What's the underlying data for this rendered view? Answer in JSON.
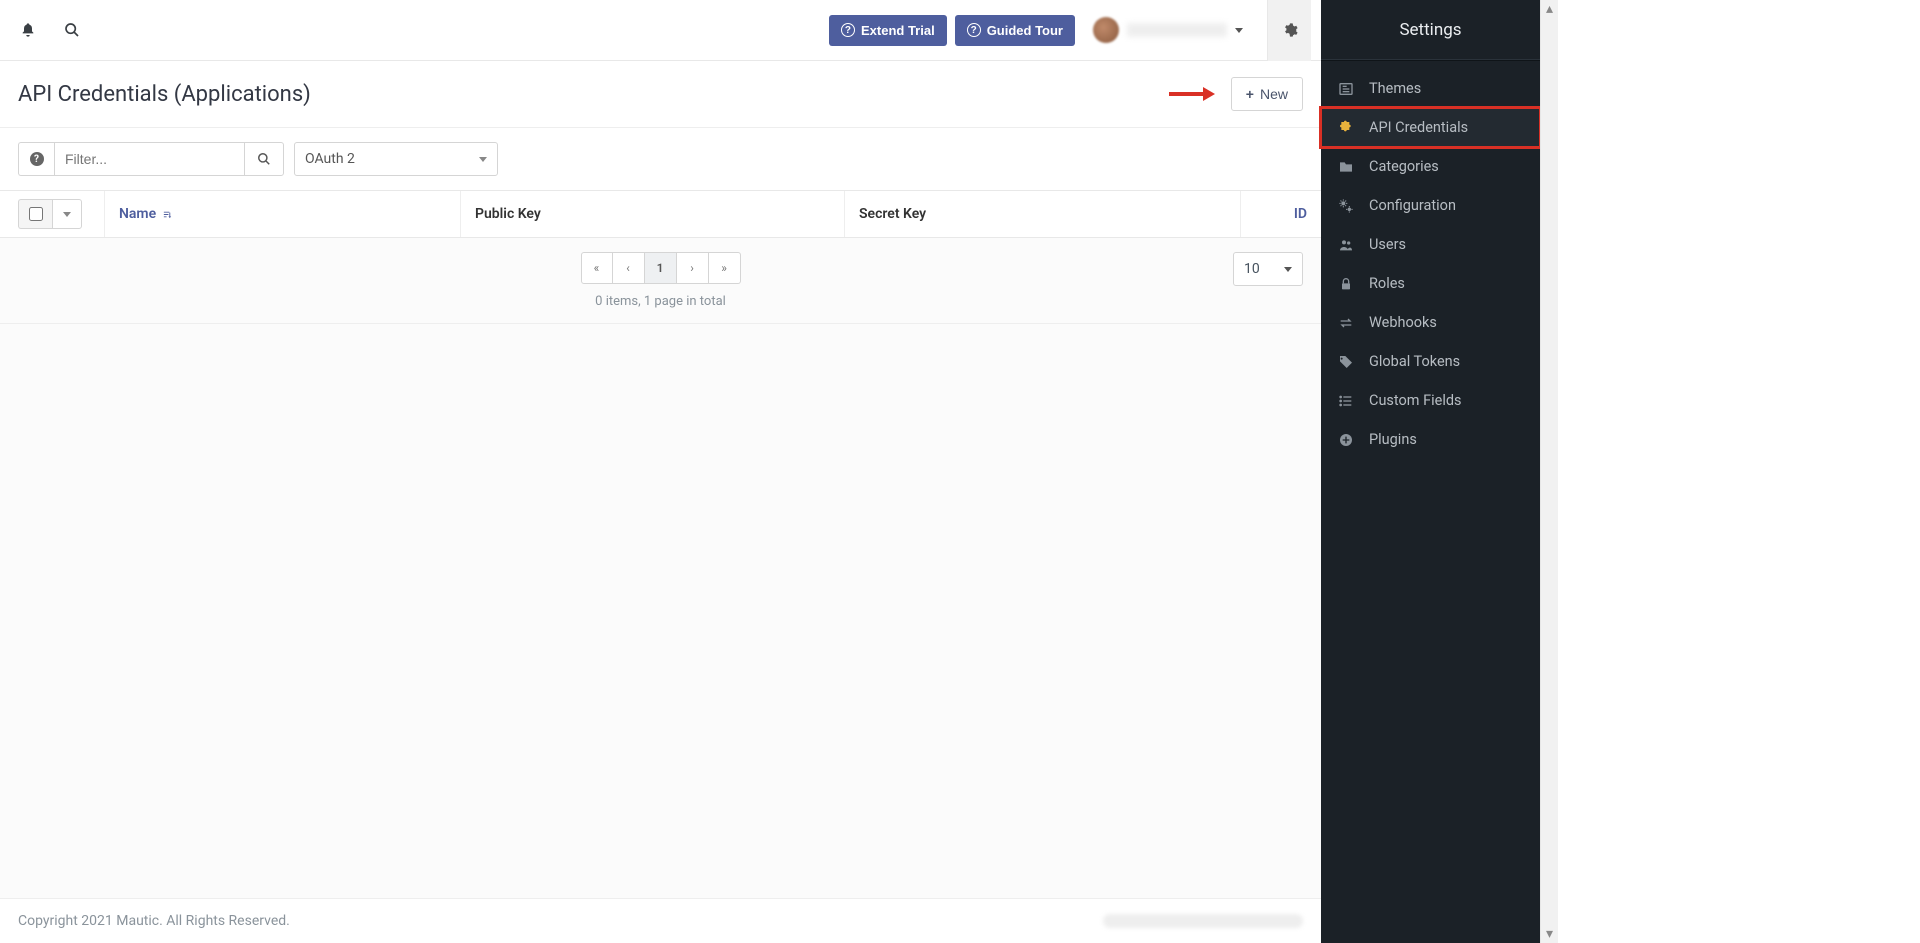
{
  "topbar": {
    "extend_trial": "Extend Trial",
    "guided_tour": "Guided Tour"
  },
  "page": {
    "title": "API Credentials (Applications)",
    "new_button": "New"
  },
  "filter": {
    "placeholder": "Filter...",
    "oauth_select": "OAuth 2"
  },
  "table": {
    "headers": {
      "name": "Name",
      "public_key": "Public Key",
      "secret_key": "Secret Key",
      "id": "ID"
    }
  },
  "pagination": {
    "current": "1",
    "info": "0 items, 1 page in total",
    "page_size": "10"
  },
  "footer": {
    "copyright": "Copyright 2021 Mautic. All Rights Reserved."
  },
  "settings": {
    "title": "Settings",
    "items": [
      {
        "label": "Themes",
        "icon": "newspaper"
      },
      {
        "label": "API Credentials",
        "icon": "puzzle",
        "active": true
      },
      {
        "label": "Categories",
        "icon": "folder"
      },
      {
        "label": "Configuration",
        "icon": "gears"
      },
      {
        "label": "Users",
        "icon": "users"
      },
      {
        "label": "Roles",
        "icon": "lock"
      },
      {
        "label": "Webhooks",
        "icon": "exchange"
      },
      {
        "label": "Global Tokens",
        "icon": "tags"
      },
      {
        "label": "Custom Fields",
        "icon": "list"
      },
      {
        "label": "Plugins",
        "icon": "plus-circle"
      }
    ]
  }
}
